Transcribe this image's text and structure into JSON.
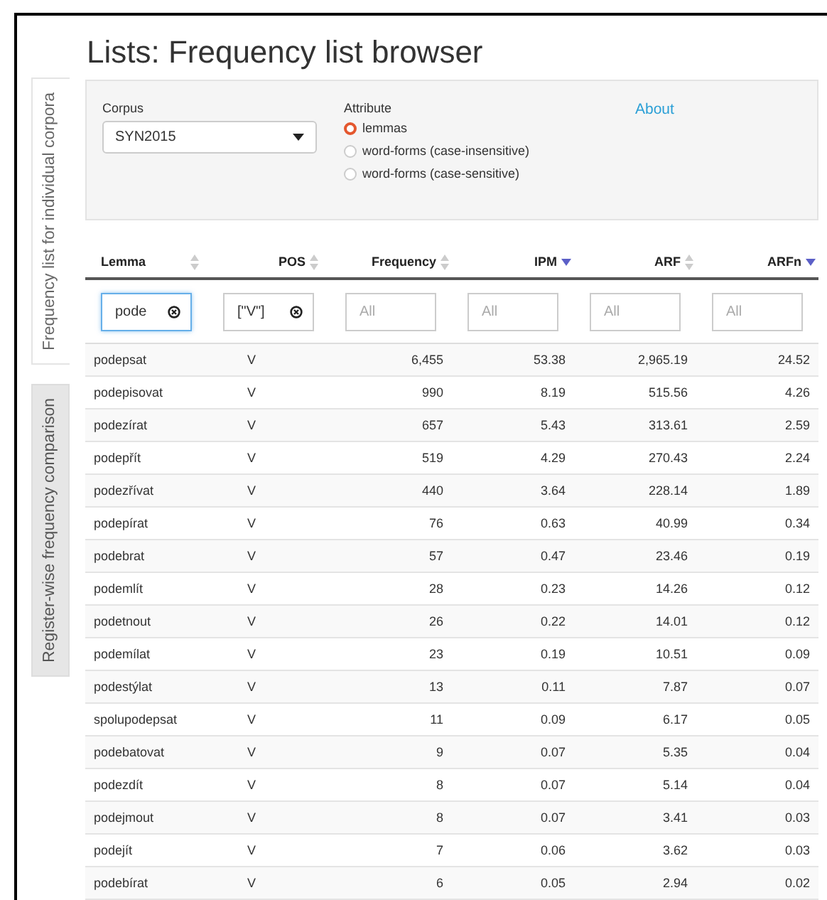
{
  "title": "Lists: Frequency list browser",
  "side_tabs": [
    {
      "label": "Frequency list for individual corpora",
      "selected": true
    },
    {
      "label": "Register-wise frequency comparison",
      "selected": false
    }
  ],
  "settings": {
    "corpus": {
      "label": "Corpus",
      "value": "SYN2015"
    },
    "attribute": {
      "label": "Attribute",
      "options": [
        {
          "label": "lemmas",
          "selected": true
        },
        {
          "label": "word-forms (case-insensitive)",
          "selected": false
        },
        {
          "label": "word-forms (case-sensitive)",
          "selected": false
        }
      ]
    },
    "about_link": "About"
  },
  "table": {
    "columns": [
      {
        "label": "Lemma",
        "sorted": false
      },
      {
        "label": "POS",
        "sorted": false
      },
      {
        "label": "Frequency",
        "sorted": false
      },
      {
        "label": "IPM",
        "sorted": true
      },
      {
        "label": "ARF",
        "sorted": false
      },
      {
        "label": "ARFn",
        "sorted": true
      }
    ],
    "filters": [
      {
        "value": "pode",
        "focused": true,
        "clearable": true
      },
      {
        "value": "[\"V\"]",
        "focused": false,
        "clearable": true
      },
      {
        "placeholder": "All",
        "focused": false,
        "clearable": false
      },
      {
        "placeholder": "All",
        "focused": false,
        "clearable": false
      },
      {
        "placeholder": "All",
        "focused": false,
        "clearable": false
      },
      {
        "placeholder": "All",
        "focused": false,
        "clearable": false
      }
    ],
    "rows": [
      [
        "podepsat",
        "V",
        "6,455",
        "53.38",
        "2,965.19",
        "24.52"
      ],
      [
        "podepisovat",
        "V",
        "990",
        "8.19",
        "515.56",
        "4.26"
      ],
      [
        "podezírat",
        "V",
        "657",
        "5.43",
        "313.61",
        "2.59"
      ],
      [
        "podepřít",
        "V",
        "519",
        "4.29",
        "270.43",
        "2.24"
      ],
      [
        "podezřívat",
        "V",
        "440",
        "3.64",
        "228.14",
        "1.89"
      ],
      [
        "podepírat",
        "V",
        "76",
        "0.63",
        "40.99",
        "0.34"
      ],
      [
        "podebrat",
        "V",
        "57",
        "0.47",
        "23.46",
        "0.19"
      ],
      [
        "podemlít",
        "V",
        "28",
        "0.23",
        "14.26",
        "0.12"
      ],
      [
        "podetnout",
        "V",
        "26",
        "0.22",
        "14.01",
        "0.12"
      ],
      [
        "podemílat",
        "V",
        "23",
        "0.19",
        "10.51",
        "0.09"
      ],
      [
        "podestýlat",
        "V",
        "13",
        "0.11",
        "7.87",
        "0.07"
      ],
      [
        "spolupodepsat",
        "V",
        "11",
        "0.09",
        "6.17",
        "0.05"
      ],
      [
        "podebatovat",
        "V",
        "9",
        "0.07",
        "5.35",
        "0.04"
      ],
      [
        "podezdít",
        "V",
        "8",
        "0.07",
        "5.14",
        "0.04"
      ],
      [
        "podejmout",
        "V",
        "8",
        "0.07",
        "3.41",
        "0.03"
      ],
      [
        "podejít",
        "V",
        "7",
        "0.06",
        "3.62",
        "0.03"
      ],
      [
        "podebírat",
        "V",
        "6",
        "0.05",
        "2.94",
        "0.02"
      ]
    ]
  }
}
